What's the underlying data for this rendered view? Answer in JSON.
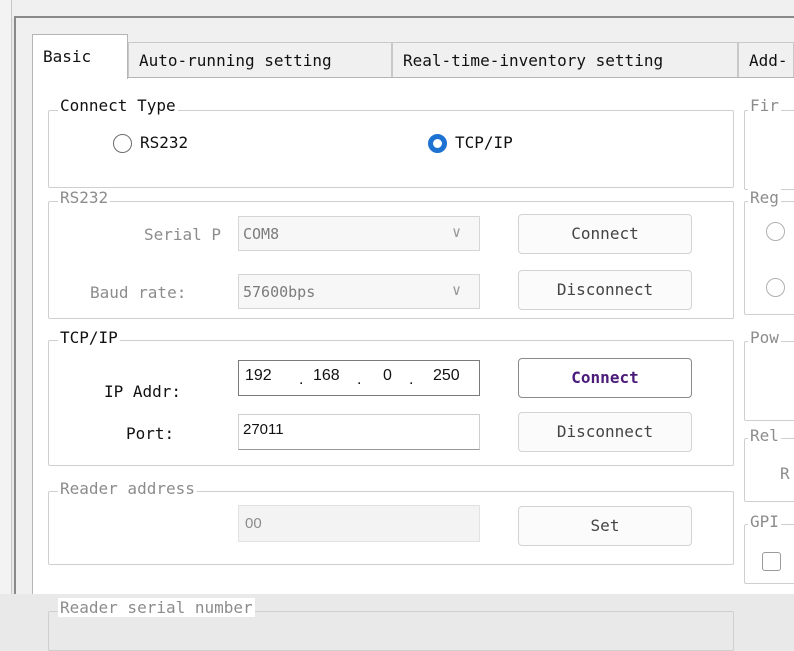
{
  "tabs": [
    "Basic",
    "Auto-running setting",
    "Real-time-inventory setting",
    "Add-"
  ],
  "connect_type": {
    "legend": "Connect Type",
    "options": [
      "RS232",
      "TCP/IP"
    ],
    "selected": "TCP/IP"
  },
  "rs232": {
    "legend": "RS232",
    "serial_port_label": "Serial P",
    "serial_port_value": "COM8",
    "baud_label": "Baud rate:",
    "baud_value": "57600bps",
    "connect_label": "Connect",
    "disconnect_label": "Disconnect"
  },
  "tcpip": {
    "legend": "TCP/IP",
    "ip_label": "IP Addr:",
    "ip_octets": [
      "192",
      "168",
      "0",
      "250"
    ],
    "ip_dot": ".",
    "port_label": "Port:",
    "port_value": "27011",
    "connect_label": "Connect",
    "disconnect_label": "Disconnect"
  },
  "reader_address": {
    "legend": "Reader address",
    "value": "00",
    "set_label": "Set"
  },
  "reader_serial": {
    "legend": "Reader serial number"
  },
  "right_column": {
    "firmware_legend": "Fir",
    "region_legend": "Reg",
    "power_legend": "Pow",
    "relay_legend": "Rel",
    "relay_text": "R",
    "gpio_legend": "GPI"
  },
  "colors": {
    "radio_selected": "#1e72d2",
    "primary_button_text": "#4b1b7a"
  }
}
